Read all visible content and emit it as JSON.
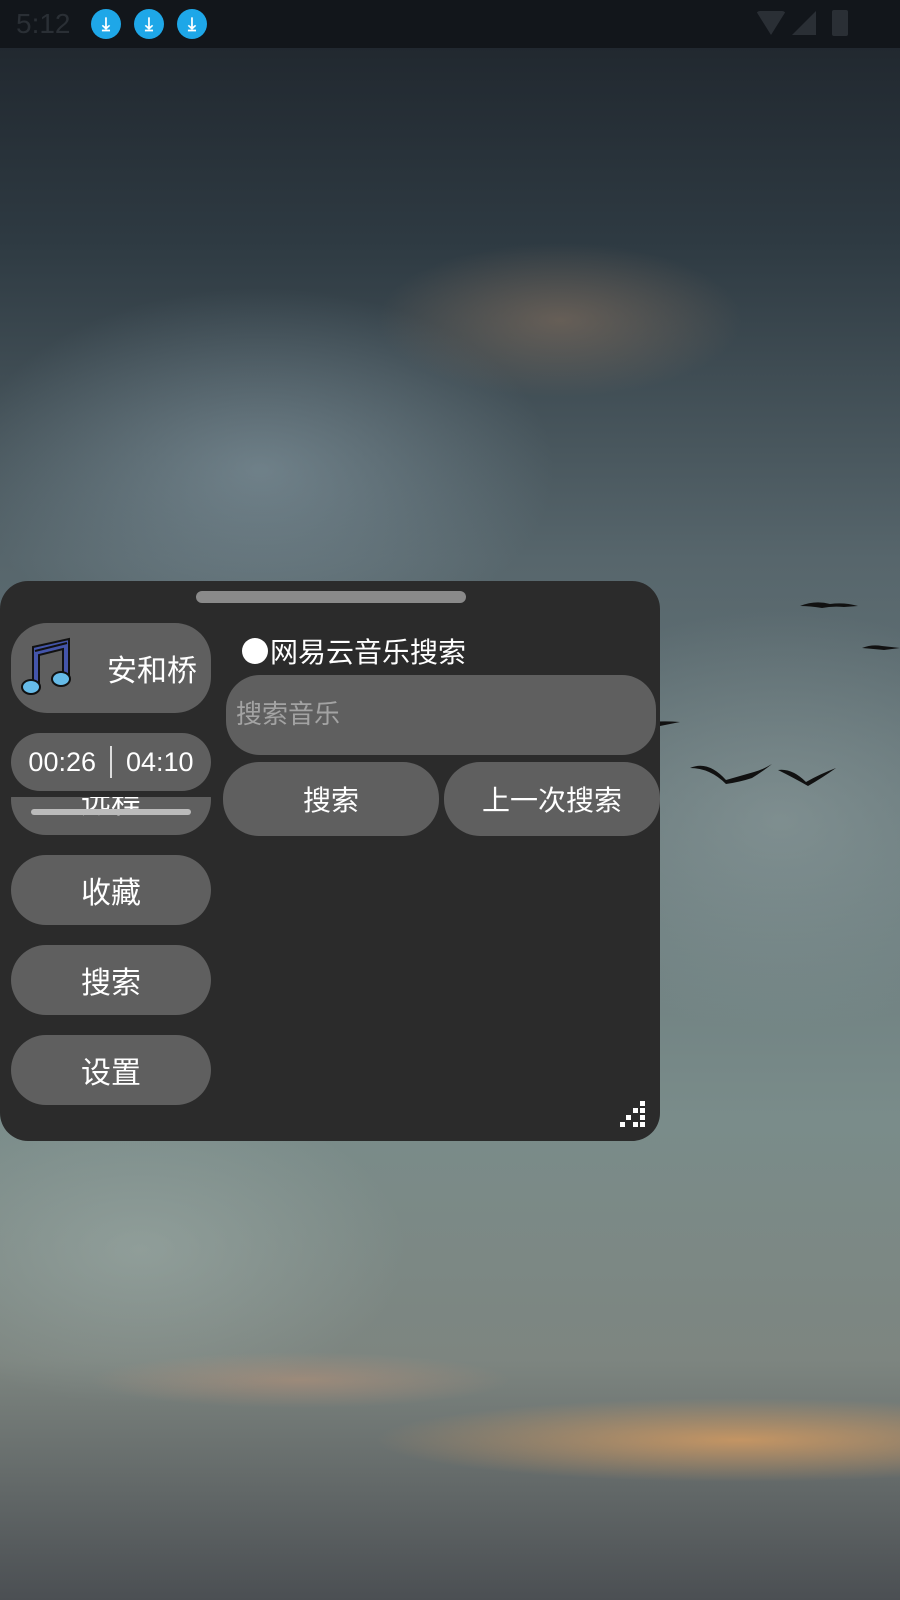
{
  "status_bar": {
    "time": "5:12",
    "notifications": [
      "download-icon",
      "download-icon",
      "download-icon"
    ],
    "right_icons": [
      "wifi-icon",
      "signal-icon",
      "battery-charging-icon"
    ]
  },
  "player": {
    "song_title": "安和桥",
    "current_time": "00:26",
    "total_time": "04:10",
    "nav_items": [
      {
        "label": "远程"
      },
      {
        "label": "收藏"
      },
      {
        "label": "搜索"
      },
      {
        "label": "设置"
      }
    ]
  },
  "search": {
    "source_label": "网易云音乐搜索",
    "placeholder": "搜索音乐",
    "value": "",
    "search_button": "搜索",
    "last_search_button": "上一次搜索"
  },
  "colors": {
    "panel": "#2b2b2b",
    "button": "#5f5f5f",
    "accent_download": "#1ea7e8"
  }
}
